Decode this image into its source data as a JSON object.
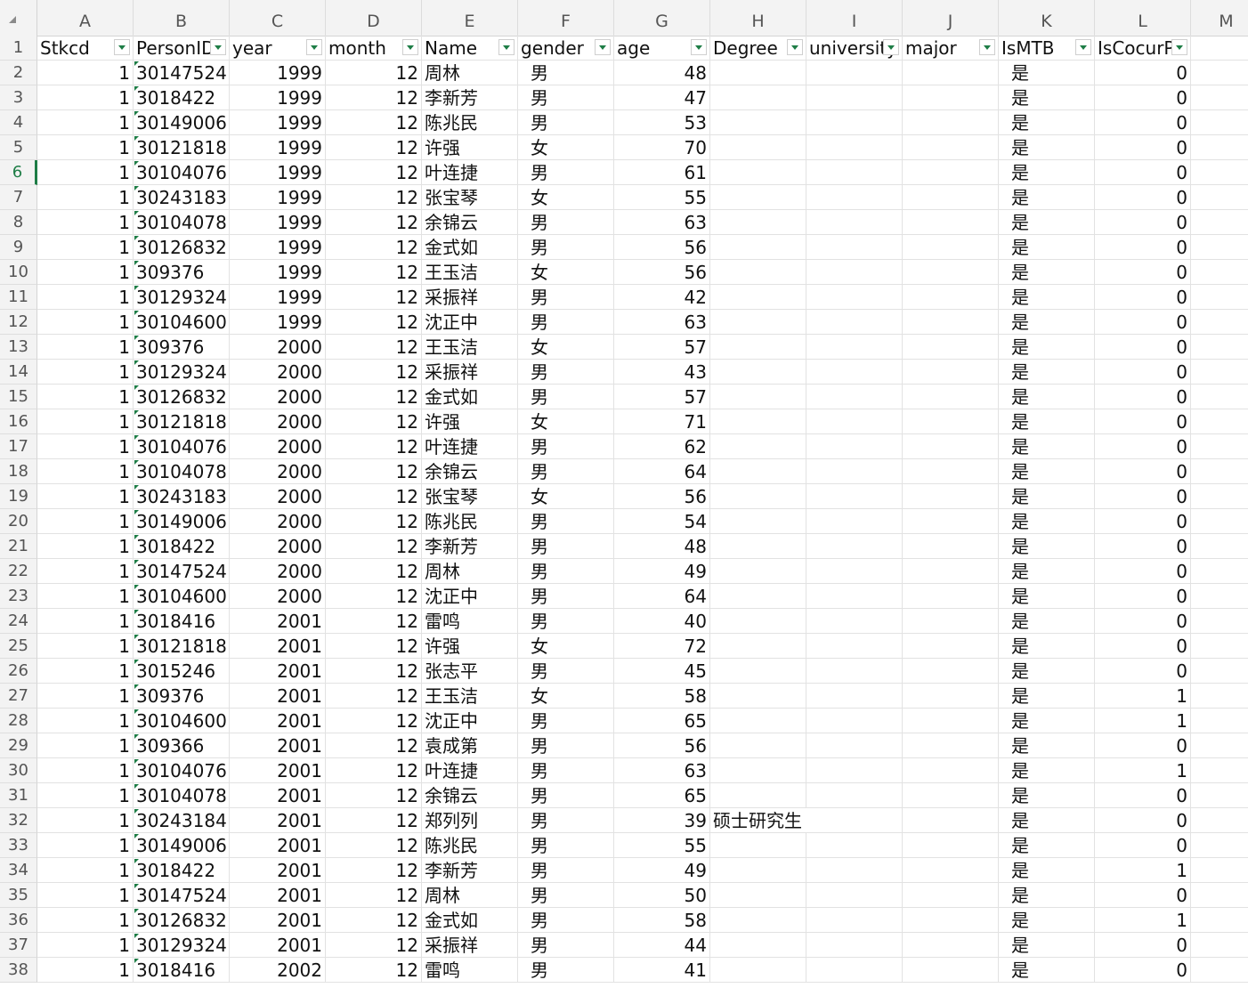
{
  "columns": [
    {
      "letter": "A",
      "header": "Stkcd"
    },
    {
      "letter": "B",
      "header": "PersonID"
    },
    {
      "letter": "C",
      "header": "year"
    },
    {
      "letter": "D",
      "header": "month"
    },
    {
      "letter": "E",
      "header": "Name"
    },
    {
      "letter": "F",
      "header": "gender"
    },
    {
      "letter": "G",
      "header": "age"
    },
    {
      "letter": "H",
      "header": "Degree"
    },
    {
      "letter": "I",
      "header": "university"
    },
    {
      "letter": "J",
      "header": "major"
    },
    {
      "letter": "K",
      "header": "IsMTB"
    },
    {
      "letter": "L",
      "header": "IsCocurP"
    },
    {
      "letter": "M",
      "header": ""
    }
  ],
  "active_row": 6,
  "rows": [
    [
      1,
      "30147524",
      1999,
      12,
      "周林",
      "男",
      48,
      "",
      "是",
      0
    ],
    [
      1,
      "3018422",
      1999,
      12,
      "李新芳",
      "男",
      47,
      "",
      "是",
      0
    ],
    [
      1,
      "30149006",
      1999,
      12,
      "陈兆民",
      "男",
      53,
      "",
      "是",
      0
    ],
    [
      1,
      "30121818",
      1999,
      12,
      "许强",
      "女",
      70,
      "",
      "是",
      0
    ],
    [
      1,
      "30104076",
      1999,
      12,
      "叶连捷",
      "男",
      61,
      "",
      "是",
      0
    ],
    [
      1,
      "30243183",
      1999,
      12,
      "张宝琴",
      "女",
      55,
      "",
      "是",
      0
    ],
    [
      1,
      "30104078",
      1999,
      12,
      "余锦云",
      "男",
      63,
      "",
      "是",
      0
    ],
    [
      1,
      "30126832",
      1999,
      12,
      "金式如",
      "男",
      56,
      "",
      "是",
      0
    ],
    [
      1,
      "309376",
      1999,
      12,
      "王玉洁",
      "女",
      56,
      "",
      "是",
      0
    ],
    [
      1,
      "30129324",
      1999,
      12,
      "采振祥",
      "男",
      42,
      "",
      "是",
      0
    ],
    [
      1,
      "30104600",
      1999,
      12,
      "沈正中",
      "男",
      63,
      "",
      "是",
      0
    ],
    [
      1,
      "309376",
      2000,
      12,
      "王玉洁",
      "女",
      57,
      "",
      "是",
      0
    ],
    [
      1,
      "30129324",
      2000,
      12,
      "采振祥",
      "男",
      43,
      "",
      "是",
      0
    ],
    [
      1,
      "30126832",
      2000,
      12,
      "金式如",
      "男",
      57,
      "",
      "是",
      0
    ],
    [
      1,
      "30121818",
      2000,
      12,
      "许强",
      "女",
      71,
      "",
      "是",
      0
    ],
    [
      1,
      "30104076",
      2000,
      12,
      "叶连捷",
      "男",
      62,
      "",
      "是",
      0
    ],
    [
      1,
      "30104078",
      2000,
      12,
      "余锦云",
      "男",
      64,
      "",
      "是",
      0
    ],
    [
      1,
      "30243183",
      2000,
      12,
      "张宝琴",
      "女",
      56,
      "",
      "是",
      0
    ],
    [
      1,
      "30149006",
      2000,
      12,
      "陈兆民",
      "男",
      54,
      "",
      "是",
      0
    ],
    [
      1,
      "3018422",
      2000,
      12,
      "李新芳",
      "男",
      48,
      "",
      "是",
      0
    ],
    [
      1,
      "30147524",
      2000,
      12,
      "周林",
      "男",
      49,
      "",
      "是",
      0
    ],
    [
      1,
      "30104600",
      2000,
      12,
      "沈正中",
      "男",
      64,
      "",
      "是",
      0
    ],
    [
      1,
      "3018416",
      2001,
      12,
      "雷鸣",
      "男",
      40,
      "",
      "是",
      0
    ],
    [
      1,
      "30121818",
      2001,
      12,
      "许强",
      "女",
      72,
      "",
      "是",
      0
    ],
    [
      1,
      "3015246",
      2001,
      12,
      "张志平",
      "男",
      45,
      "",
      "是",
      0
    ],
    [
      1,
      "309376",
      2001,
      12,
      "王玉洁",
      "女",
      58,
      "",
      "是",
      1
    ],
    [
      1,
      "30104600",
      2001,
      12,
      "沈正中",
      "男",
      65,
      "",
      "是",
      1
    ],
    [
      1,
      "309366",
      2001,
      12,
      "袁成第",
      "男",
      56,
      "",
      "是",
      0
    ],
    [
      1,
      "30104076",
      2001,
      12,
      "叶连捷",
      "男",
      63,
      "",
      "是",
      1
    ],
    [
      1,
      "30104078",
      2001,
      12,
      "余锦云",
      "男",
      65,
      "",
      "是",
      0
    ],
    [
      1,
      "30243184",
      2001,
      12,
      "郑列列",
      "男",
      39,
      "硕士研究生",
      "是",
      0
    ],
    [
      1,
      "30149006",
      2001,
      12,
      "陈兆民",
      "男",
      55,
      "",
      "是",
      0
    ],
    [
      1,
      "3018422",
      2001,
      12,
      "李新芳",
      "男",
      49,
      "",
      "是",
      1
    ],
    [
      1,
      "30147524",
      2001,
      12,
      "周林",
      "男",
      50,
      "",
      "是",
      0
    ],
    [
      1,
      "30126832",
      2001,
      12,
      "金式如",
      "男",
      58,
      "",
      "是",
      1
    ],
    [
      1,
      "30129324",
      2001,
      12,
      "采振祥",
      "男",
      44,
      "",
      "是",
      0
    ],
    [
      1,
      "3018416",
      2002,
      12,
      "雷鸣",
      "男",
      41,
      "",
      "是",
      0
    ]
  ]
}
